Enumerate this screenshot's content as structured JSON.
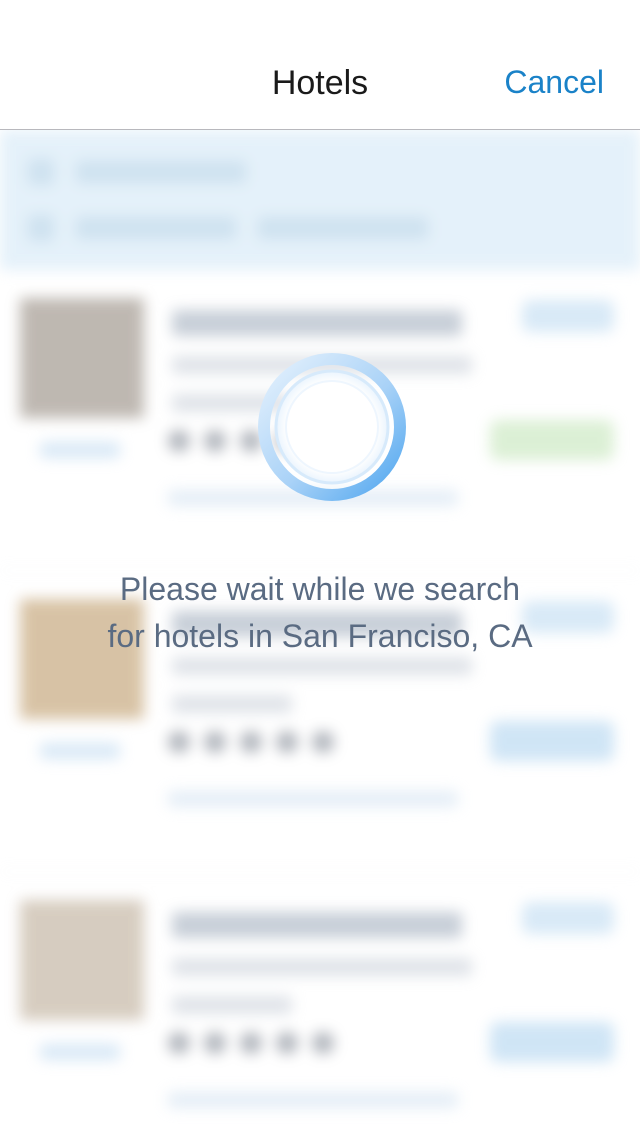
{
  "navbar": {
    "title": "Hotels",
    "cancel_label": "Cancel"
  },
  "loading": {
    "message_line1": "Please wait while we search",
    "message_line2": "for hotels in San Franciso, CA"
  },
  "colors": {
    "accent": "#1a82c8",
    "spinner": "#5aaef2",
    "message_text": "#5a6b82"
  }
}
